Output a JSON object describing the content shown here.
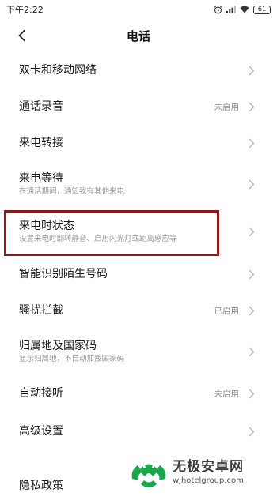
{
  "status": {
    "time": "下午2:22",
    "battery": "61"
  },
  "header": {
    "title": "电话"
  },
  "items": [
    {
      "title": "双卡和移动网络",
      "subtitle": "",
      "value": ""
    },
    {
      "title": "通话录音",
      "subtitle": "",
      "value": "未启用"
    },
    {
      "title": "来电转接",
      "subtitle": "",
      "value": ""
    },
    {
      "title": "来电等待",
      "subtitle": "在通话期间，通知我有其他来电",
      "value": ""
    },
    {
      "title": "来电时状态",
      "subtitle": "设置来电时翻转静音、启用闪光灯或距离感应等",
      "value": ""
    },
    {
      "title": "智能识别陌生号码",
      "subtitle": "",
      "value": ""
    },
    {
      "title": "骚扰拦截",
      "subtitle": "",
      "value": "已启用"
    },
    {
      "title": "归属地及国家码",
      "subtitle": "显示归属地，不自动加拨国家码",
      "value": ""
    },
    {
      "title": "自动接听",
      "subtitle": "",
      "value": "未启用"
    },
    {
      "title": "高级设置",
      "subtitle": "",
      "value": ""
    },
    {
      "title": "隐私政策",
      "subtitle": "",
      "value": ""
    }
  ],
  "watermark": {
    "title": "无极安卓网",
    "url": "wjhotelgroup.com"
  },
  "colors": {
    "highlight": "#8b1a1a",
    "logo_green": "#1aa64a"
  }
}
